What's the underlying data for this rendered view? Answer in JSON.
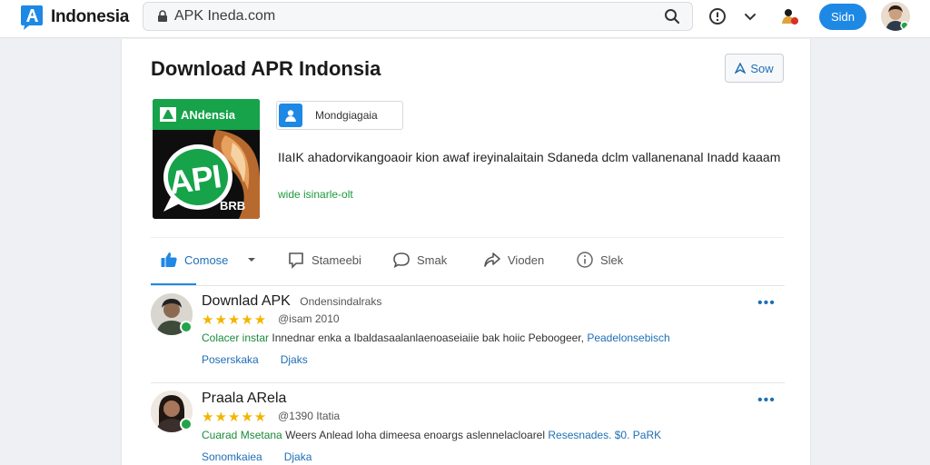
{
  "header": {
    "brand": "Indonesia",
    "url": "APK Ineda.com",
    "signin_label": "Sidn"
  },
  "page": {
    "title": "Download APR Indonsia",
    "save_label": "Sow"
  },
  "app": {
    "banner_text": "ANdensia",
    "logo_text": "API",
    "corner_text": "BRB",
    "developer": "Mondgiagaia",
    "description": "IIaIK ahadorvikangoaoir kion awaf ireyinalaitain Sdaneda dclm vallanenanal Inadd kaaam",
    "link": "wide isinarle-olt"
  },
  "tabs": [
    {
      "label": "Comose",
      "icon": "thumbs-up-icon"
    },
    {
      "label": "Stameebi",
      "icon": "comment-box-icon"
    },
    {
      "label": "Smak",
      "icon": "chat-bubble-icon"
    },
    {
      "label": "Vioden",
      "icon": "share-icon"
    },
    {
      "label": "Slek",
      "icon": "info-icon"
    }
  ],
  "reviews": [
    {
      "name": "Downlad APK",
      "subtitle": "Ondensindalraks",
      "stars": "★★★★★",
      "date": "@isam 2010",
      "text_green": "Colacer instar",
      "text_dark": "Innednar enka a Ibaldasaalanlaenoaseiaiie bak hoiic Peboogeer,",
      "text_link": "Peadelonsebisch",
      "action_1": "Poserskaka",
      "action_2": "Djaks"
    },
    {
      "name": "Praala ARela",
      "subtitle": "",
      "stars": "★★★★★",
      "date": "@1390 Itatia",
      "text_green": "Cuarad Msetana",
      "text_dark": "Weers Anlead loha dimeesa enoargs aslennelacloarel",
      "text_link": "Resesnades. $0. PaRK",
      "action_1": "Sonomkaiea",
      "action_2": "Djaka"
    }
  ],
  "colors": {
    "accent": "#1e88e5",
    "brand_green": "#16a34a",
    "star": "#f4b400"
  }
}
